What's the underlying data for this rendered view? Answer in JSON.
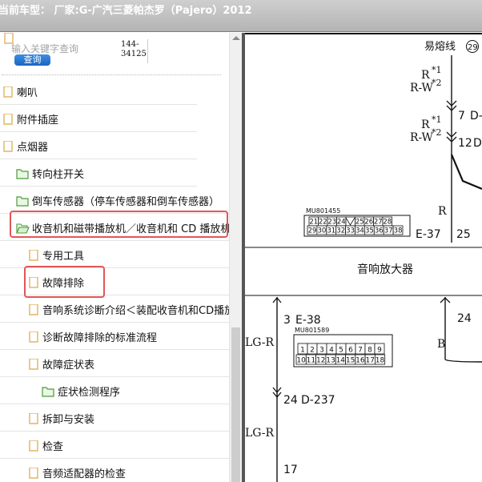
{
  "titlebar": {
    "text": "当前车型： 厂家:G-广汽三菱帕杰罗（Pajero）2012"
  },
  "search": {
    "placeholder": "输入关键字查询",
    "button_label": "查询",
    "code_line1": "144-",
    "code_line2": "34125"
  },
  "tree": {
    "items": [
      {
        "label": "喇叭",
        "icon": "file-icon"
      },
      {
        "label": "附件插座",
        "icon": "file-icon"
      },
      {
        "label": "点烟器",
        "icon": "file-icon"
      },
      {
        "label": "转向柱开关",
        "icon": "folder-closed-icon"
      },
      {
        "label": "倒车传感器（停车传感器和倒车传感器）",
        "icon": "folder-closed-icon"
      },
      {
        "label": "收音机和磁带播放机／收音机和 CD 播放机",
        "icon": "folder-open-icon",
        "highlighted": true
      },
      {
        "label": "专用工具",
        "icon": "file-icon"
      },
      {
        "label": "故障排除",
        "icon": "file-icon",
        "highlighted": true
      },
      {
        "label": "音响系统诊断介绍＜装配收音机和CD播放",
        "icon": "file-icon"
      },
      {
        "label": "诊断故障排除的标准流程",
        "icon": "file-icon"
      },
      {
        "label": "故障症状表",
        "icon": "file-icon"
      },
      {
        "label": "症状检测程序",
        "icon": "folder-closed-icon"
      },
      {
        "label": "拆卸与安装",
        "icon": "file-icon"
      },
      {
        "label": "检查",
        "icon": "file-icon"
      },
      {
        "label": "音频适配器的检查",
        "icon": "file-icon"
      }
    ]
  },
  "diagram": {
    "fuse_line": "易熔线",
    "fuse_number": "29",
    "wire_r_1": "R",
    "wire_r_1_sup": "*1",
    "wire_rw_1": "R-W",
    "wire_rw_1_sup": "*2",
    "pin_7": "7",
    "conn_7": "D-",
    "wire_r_2": "R",
    "wire_r_2_sup": "*1",
    "wire_rw_2": "R-W",
    "wire_rw_2_sup": "*2",
    "pin_12": "12",
    "conn_12": "D-",
    "wire_r_3": "R",
    "conn_e37": "E-37",
    "pin_25": "25",
    "part_mu801455": "MU801455",
    "conn_rows_1": [
      "21",
      "22",
      "23",
      "24",
      "",
      "25",
      "26",
      "27",
      "28"
    ],
    "conn_rows_2": [
      "29",
      "30",
      "31",
      "32",
      "33",
      "34",
      "35",
      "36",
      "37",
      "38"
    ],
    "amplifier": "音响放大器",
    "pin_3": "3",
    "conn_e38": "E-38",
    "part_mu801589": "MU801589",
    "conn_rows_3": [
      "1",
      "2",
      "3",
      "4",
      "5",
      "6",
      "7",
      "8",
      "9"
    ],
    "conn_rows_4": [
      "10",
      "11",
      "12",
      "13",
      "14",
      "15",
      "16",
      "17",
      "18"
    ],
    "wire_lgr_1": "LG-R",
    "pin_24": "24",
    "wire_b": "B",
    "pin_24b": "24",
    "conn_d237": "D-237",
    "wire_lgr_2": "LG-R",
    "pin_17": "17"
  },
  "colors": {
    "highlight": "#e05757",
    "button": "#1a66bf",
    "splitter": "#565656"
  }
}
